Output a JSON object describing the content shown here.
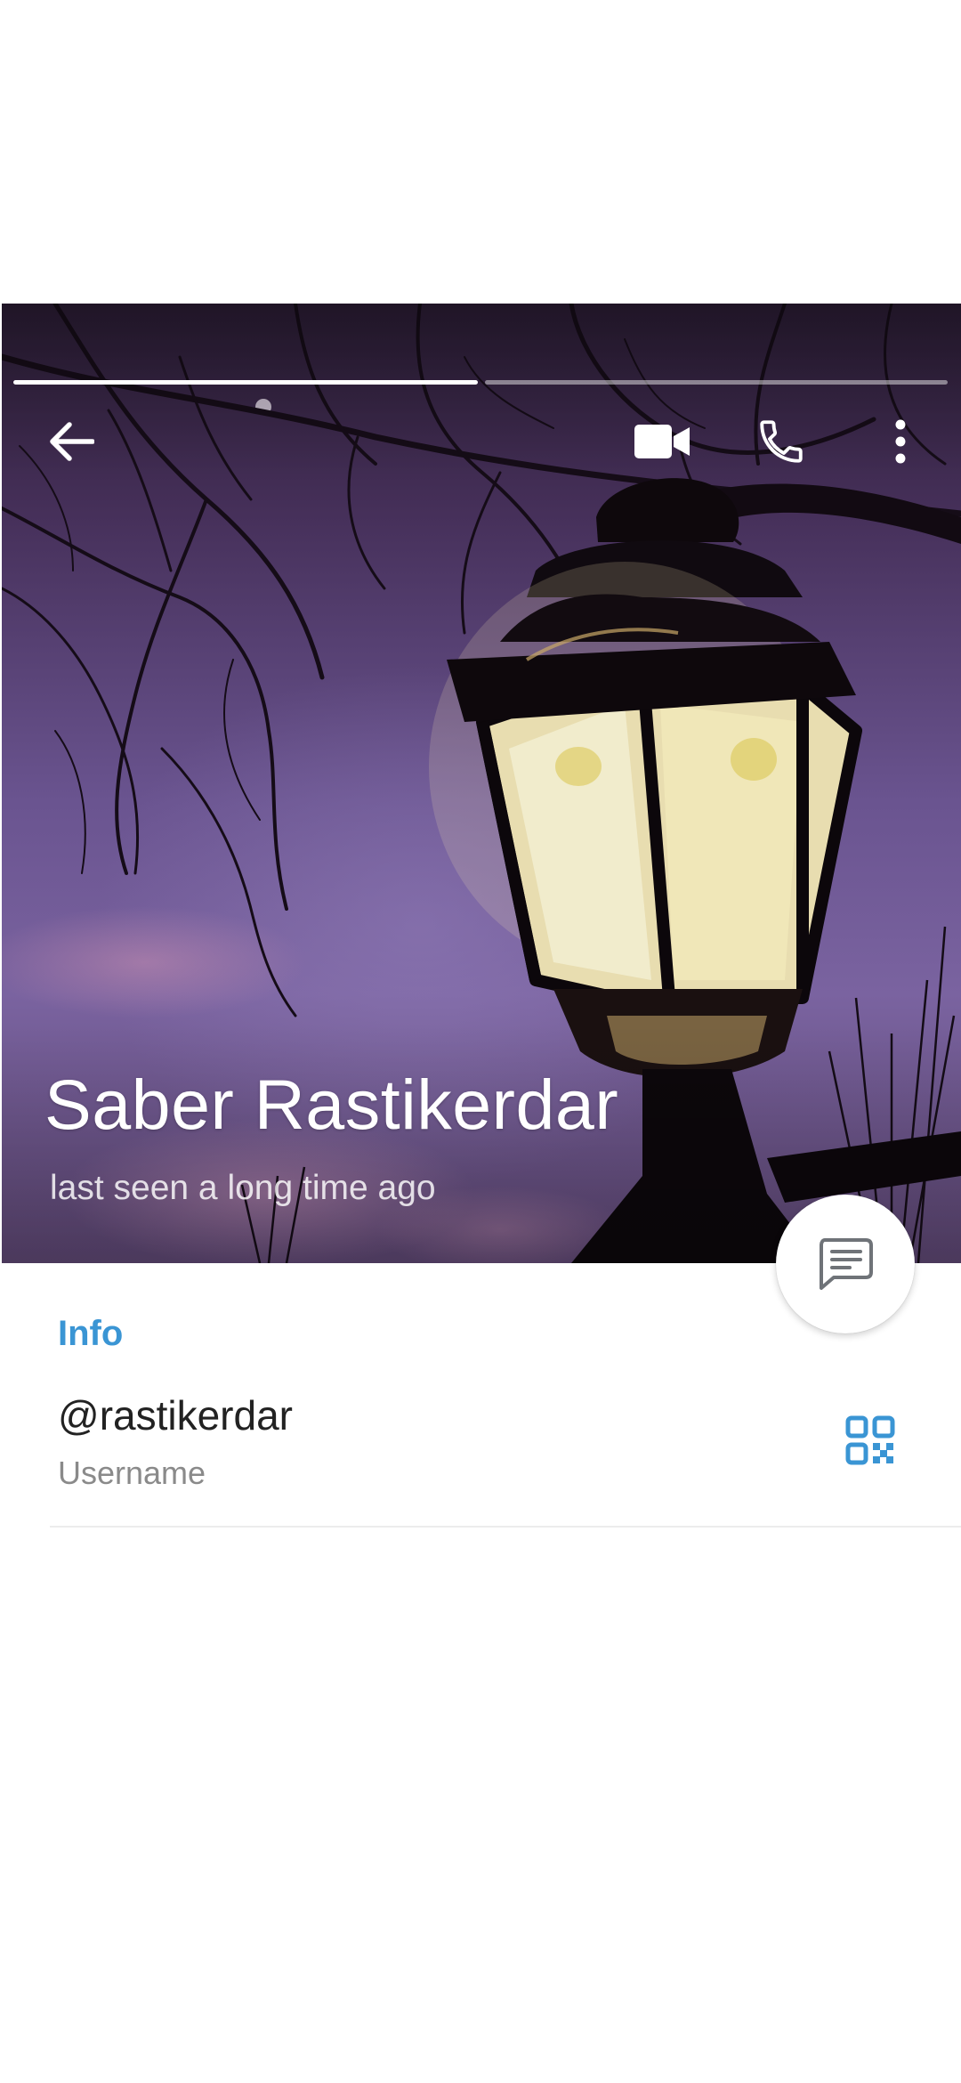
{
  "profile": {
    "name": "Saber Rastikerdar",
    "status": "last seen a long time ago"
  },
  "photo_viewer": {
    "total_photos": 2,
    "current_photo": 1
  },
  "toolbar": {
    "back_icon": "arrow-left-icon",
    "video_call_icon": "video-camera-icon",
    "voice_call_icon": "phone-icon",
    "more_icon": "more-vertical-icon"
  },
  "fab": {
    "icon": "message-icon"
  },
  "info": {
    "header": "Info",
    "username": "@rastikerdar",
    "username_label": "Username",
    "qr_icon": "qr-code-icon"
  },
  "colors": {
    "accent": "#3a95d4",
    "name_text": "#ffffff",
    "secondary_text": "#8a8a8a",
    "divider": "#ececec"
  }
}
